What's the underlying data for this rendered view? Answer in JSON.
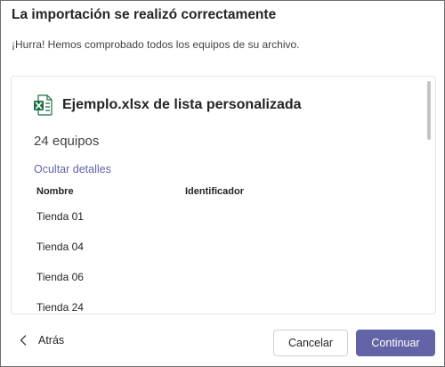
{
  "dialog": {
    "title": "La importación se realizó correctamente",
    "subtitle": "¡Hurra! Hemos comprobado todos los equipos de su archivo."
  },
  "file": {
    "icon": "excel-file-icon",
    "name": "Ejemplo.xlsx de lista personalizada",
    "team_count": "24 equipos",
    "toggle_details": "Ocultar detalles"
  },
  "table": {
    "headers": {
      "name": "Nombre",
      "id": "Identificador"
    },
    "rows": [
      {
        "name": "Tienda 01"
      },
      {
        "name": "Tienda 04"
      },
      {
        "name": "Tienda 06"
      },
      {
        "name": "Tienda 24"
      }
    ]
  },
  "footer": {
    "back_label": "Atrás",
    "back_icon": "chevron-left-icon",
    "cancel_label": "Cancelar",
    "continue_label": "Continuar"
  },
  "colors": {
    "accent": "#6264a7",
    "excel_green": "#1d7044"
  }
}
